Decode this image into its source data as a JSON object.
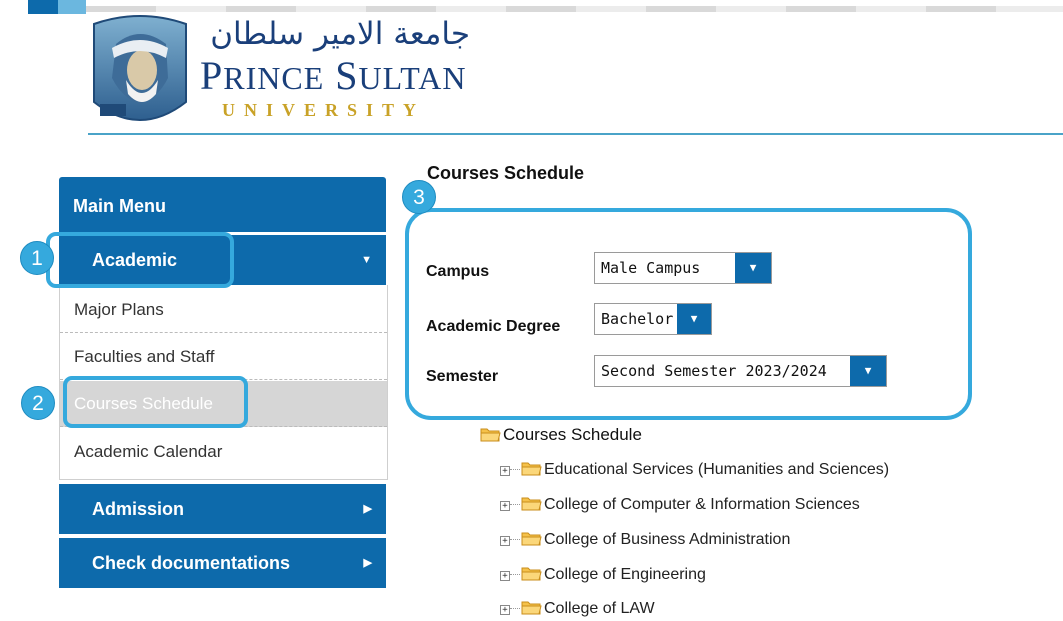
{
  "header": {
    "arabic_name": "جامعة الامير سلطان",
    "name_prefix_letter_1": "P",
    "name_rest_1": "RINCE",
    "name_prefix_letter_2": "S",
    "name_rest_2": "ULTAN",
    "university_word": "UNIVERSITY"
  },
  "sidebar": {
    "title": "Main Menu",
    "categories": [
      {
        "label": "Academic",
        "caret": "▼"
      },
      {
        "label": "Admission",
        "caret": "▶"
      },
      {
        "label": "Check documentations",
        "caret": "▶"
      }
    ],
    "academic_items": [
      {
        "label": "Major Plans",
        "active": false
      },
      {
        "label": "Faculties and Staff",
        "active": false
      },
      {
        "label": "Courses Schedule",
        "active": true
      },
      {
        "label": "Academic Calendar",
        "active": false
      }
    ]
  },
  "main": {
    "title": "Courses Schedule",
    "form": {
      "campus_label": "Campus",
      "campus_value": "Male Campus",
      "degree_label": "Academic Degree",
      "degree_value": "Bachelor",
      "semester_label": "Semester",
      "semester_value": "Second Semester 2023/2024"
    },
    "tree": {
      "root": "Courses Schedule",
      "children": [
        "Educational Services (Humanities and Sciences)",
        "College of Computer & Information Sciences",
        "College of Business Administration",
        "College of Engineering",
        "College of LAW"
      ]
    }
  },
  "annotations": {
    "step1": "1",
    "step2": "2",
    "step3": "3"
  },
  "colors": {
    "primary": "#0d6aab",
    "annotation": "#35a9dd",
    "logo_text": "#1a3f7a",
    "logo_gold": "#c9a227"
  }
}
